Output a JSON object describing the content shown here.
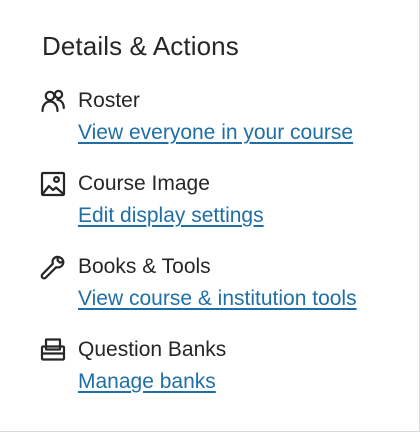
{
  "panel": {
    "title": "Details & Actions"
  },
  "items": [
    {
      "icon": "people-icon",
      "label": "Roster",
      "link": "View everyone in your course"
    },
    {
      "icon": "image-icon",
      "label": "Course Image",
      "link": "Edit display settings"
    },
    {
      "icon": "wrench-icon",
      "label": "Books & Tools",
      "link": "View course & institution tools"
    },
    {
      "icon": "question-bank-icon",
      "label": "Question Banks",
      "link": "Manage banks"
    }
  ],
  "colors": {
    "text": "#262626",
    "link": "#1f6fa6",
    "border": "#d9d9d9",
    "background": "#ffffff"
  }
}
